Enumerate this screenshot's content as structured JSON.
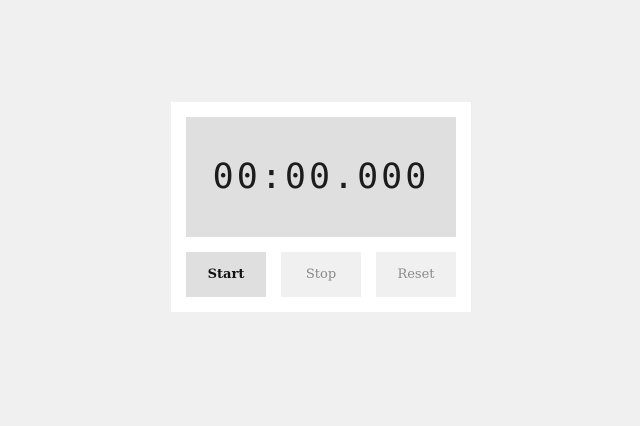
{
  "stopwatch": {
    "time": "00:00.000",
    "buttons": {
      "start_label": "Start",
      "stop_label": "Stop",
      "reset_label": "Reset"
    }
  },
  "colors": {
    "background": "#f0f0f0",
    "card": "#ffffff",
    "display": "#dfdfdf",
    "active_button": "#dfdfdf",
    "disabled_button": "#f0f0f0",
    "disabled_text": "#8a8a8a"
  }
}
